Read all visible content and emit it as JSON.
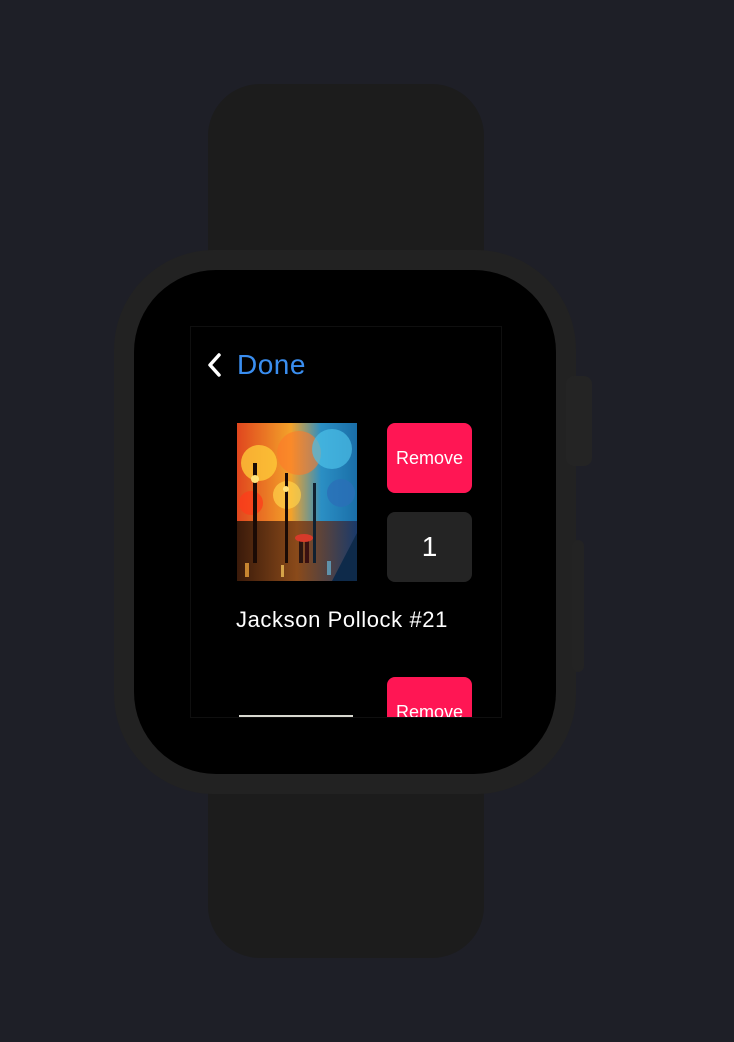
{
  "nav": {
    "back_label": "Done",
    "back_icon": "chevron-left-icon"
  },
  "items": [
    {
      "title": "Jackson Pollock #21",
      "remove_label": "Remove",
      "quantity": "1"
    },
    {
      "remove_label": "Remove"
    }
  ],
  "colors": {
    "background": "#1e1f27",
    "watch_body": "#222222",
    "screen": "#000000",
    "accent": "#3a8ef0",
    "remove": "#ff1654",
    "quantity_bg": "#242424"
  }
}
